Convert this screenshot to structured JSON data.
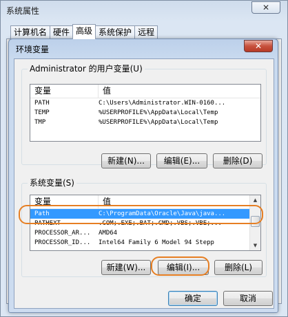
{
  "outer_window": {
    "title": "系统属性",
    "close_label": "✕",
    "tabs": [
      "计算机名",
      "硬件",
      "高级",
      "系统保护",
      "远程"
    ],
    "active_tab": 2
  },
  "dialog": {
    "title": "环境变量",
    "close_label": "✕",
    "user_section": {
      "legend": "Administrator 的用户变量(U)",
      "col_variable": "变量",
      "col_value": "值",
      "rows": [
        {
          "name": "PATH",
          "value": "C:\\Users\\Administrator.WIN-0160..."
        },
        {
          "name": "TEMP",
          "value": "%USERPROFILE%\\AppData\\Local\\Temp"
        },
        {
          "name": "TMP",
          "value": "%USERPROFILE%\\AppData\\Local\\Temp"
        }
      ],
      "new_label": "新建(N)...",
      "edit_label": "编辑(E)...",
      "delete_label": "删除(D)"
    },
    "system_section": {
      "legend": "系统变量(S)",
      "col_variable": "变量",
      "col_value": "值",
      "rows": [
        {
          "name": "Path",
          "value": "C:\\ProgramData\\Oracle\\Java\\java..."
        },
        {
          "name": "PATHEXT",
          "value": ".COM;.EXE;.BAT;.CMD;.VBS;.VBE;..."
        },
        {
          "name": "PROCESSOR_AR...",
          "value": "AMD64"
        },
        {
          "name": "PROCESSOR_ID...",
          "value": "Intel64 Family 6 Model 94 Stepp"
        }
      ],
      "selected_row": 0,
      "new_label": "新建(W)...",
      "edit_label": "编辑(I)...",
      "delete_label": "删除(L)"
    },
    "ok_label": "确定",
    "cancel_label": "取消"
  },
  "colors": {
    "selection": "#3399ff",
    "highlight_ring": "#e67e22"
  }
}
